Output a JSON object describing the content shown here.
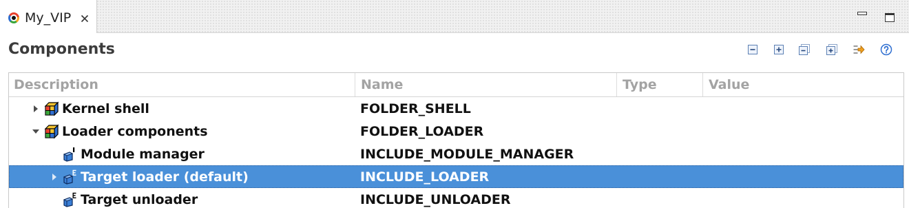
{
  "editor_tab": {
    "label": "My_VIP",
    "icon": "vip-project-icon",
    "close_icon": "close-icon",
    "active": true
  },
  "window_controls": {
    "minimize_icon": "minimize-icon",
    "maximize_icon": "maximize-icon"
  },
  "section": {
    "title": "Components"
  },
  "toolbar": {
    "icons": [
      "collapse-icon",
      "expand-icon",
      "collapse-all-icon",
      "expand-all-icon",
      "filter-icon",
      "help-icon"
    ]
  },
  "table": {
    "columns": [
      "Description",
      "Name",
      "Type",
      "Value"
    ]
  },
  "tree": [
    {
      "description": "Kernel shell",
      "name": "FOLDER_SHELL",
      "icon": "folder-icon",
      "expandable": true,
      "expanded": false
    },
    {
      "description": "Loader components",
      "name": "FOLDER_LOADER",
      "icon": "folder-icon",
      "expandable": true,
      "expanded": true,
      "children": [
        {
          "description": "Module manager",
          "name": "INCLUDE_MODULE_MANAGER",
          "icon": "component-icon",
          "expandable": false
        },
        {
          "description": "Target loader (default)",
          "name": "INCLUDE_LOADER",
          "icon": "component-e-icon",
          "expandable": true,
          "expanded": false,
          "selected": true
        },
        {
          "description": "Target unloader",
          "name": "INCLUDE_UNLOADER",
          "icon": "component-e-icon",
          "expandable": false
        }
      ]
    }
  ],
  "colors": {
    "selection_bg": "#4a90d9",
    "header_text": "#a3a3a3",
    "component_blue": "#3a7fd6"
  }
}
